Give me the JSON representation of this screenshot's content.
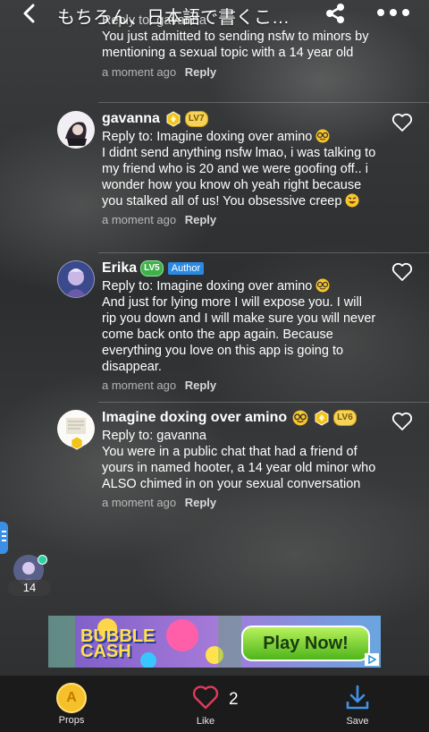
{
  "header": {
    "title": "もちろん、日本語で書くこ…"
  },
  "top_comment": {
    "reply_to": "Reply to: gavanna",
    "text": "You just admitted to sending nsfw to minors by mentioning a sexual topic with a 14 year old",
    "time": "a moment ago",
    "reply_label": "Reply"
  },
  "comments": [
    {
      "name": "gavanna",
      "level": "LV7",
      "reply_to": "Reply to: Imagine doxing over amino",
      "text": "I didnt send anything nsfw lmao, i was talking to my friend who is 20 and we were goofing off.. i wonder how you know oh yeah right because you stalked all of us! You obsessive creep",
      "time": "a moment ago",
      "reply_label": "Reply"
    },
    {
      "name": "Erika",
      "level": "LV5",
      "author_badge": "Author",
      "reply_to": "Reply to: Imagine doxing over amino",
      "text": "And just for lying more I will expose you. I will rip you down and I will make sure you will never come back onto the app again. Because everything you love on this app is going to disappear.",
      "time": "a moment ago",
      "reply_label": "Reply"
    },
    {
      "name": "Imagine doxing over amino",
      "level": "LV6",
      "reply_to": "Reply to: gavanna",
      "text": "You were in a public chat that had a friend of yours in named hooter, a 14 year old minor who ALSO chimed in on your sexual conversation",
      "time": "a moment ago",
      "reply_label": "Reply"
    }
  ],
  "online": {
    "count": "14"
  },
  "ad": {
    "brand_line1": "BUBBLE",
    "brand_line2": "CASH",
    "cta": "Play Now!"
  },
  "bottom_bar": {
    "props_label": "Props",
    "like_label": "Like",
    "like_count": "2",
    "save_label": "Save"
  },
  "colors": {
    "accent_blue": "#2a8ae3",
    "gold_badge": "#f5d25a",
    "bottom_bar_bg": "#1b1b1b"
  }
}
